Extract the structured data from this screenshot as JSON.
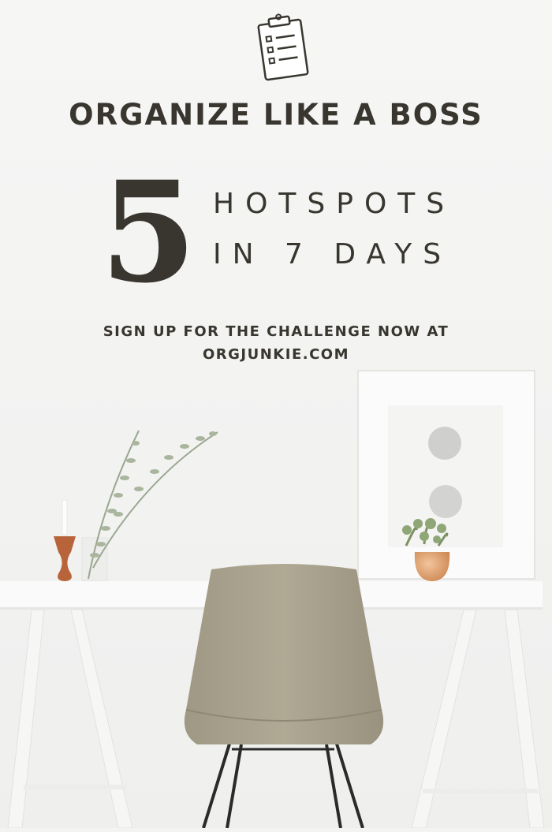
{
  "pin": {
    "icon": "clipboard-checklist-icon",
    "headline": "ORGANIZE LIKE A BOSS",
    "big_number": "5",
    "line1": "HOTSPOTS",
    "line2": "IN 7 DAYS",
    "cta_line1": "SIGN UP FOR THE CHALLENGE NOW AT",
    "cta_line2": "ORGJUNKIE.COM",
    "colors": {
      "text": "#38362f",
      "background": "#f3f3f2",
      "chair": "#a8a18e",
      "copper": "#d89a6a",
      "wood": "#b8643a"
    }
  }
}
